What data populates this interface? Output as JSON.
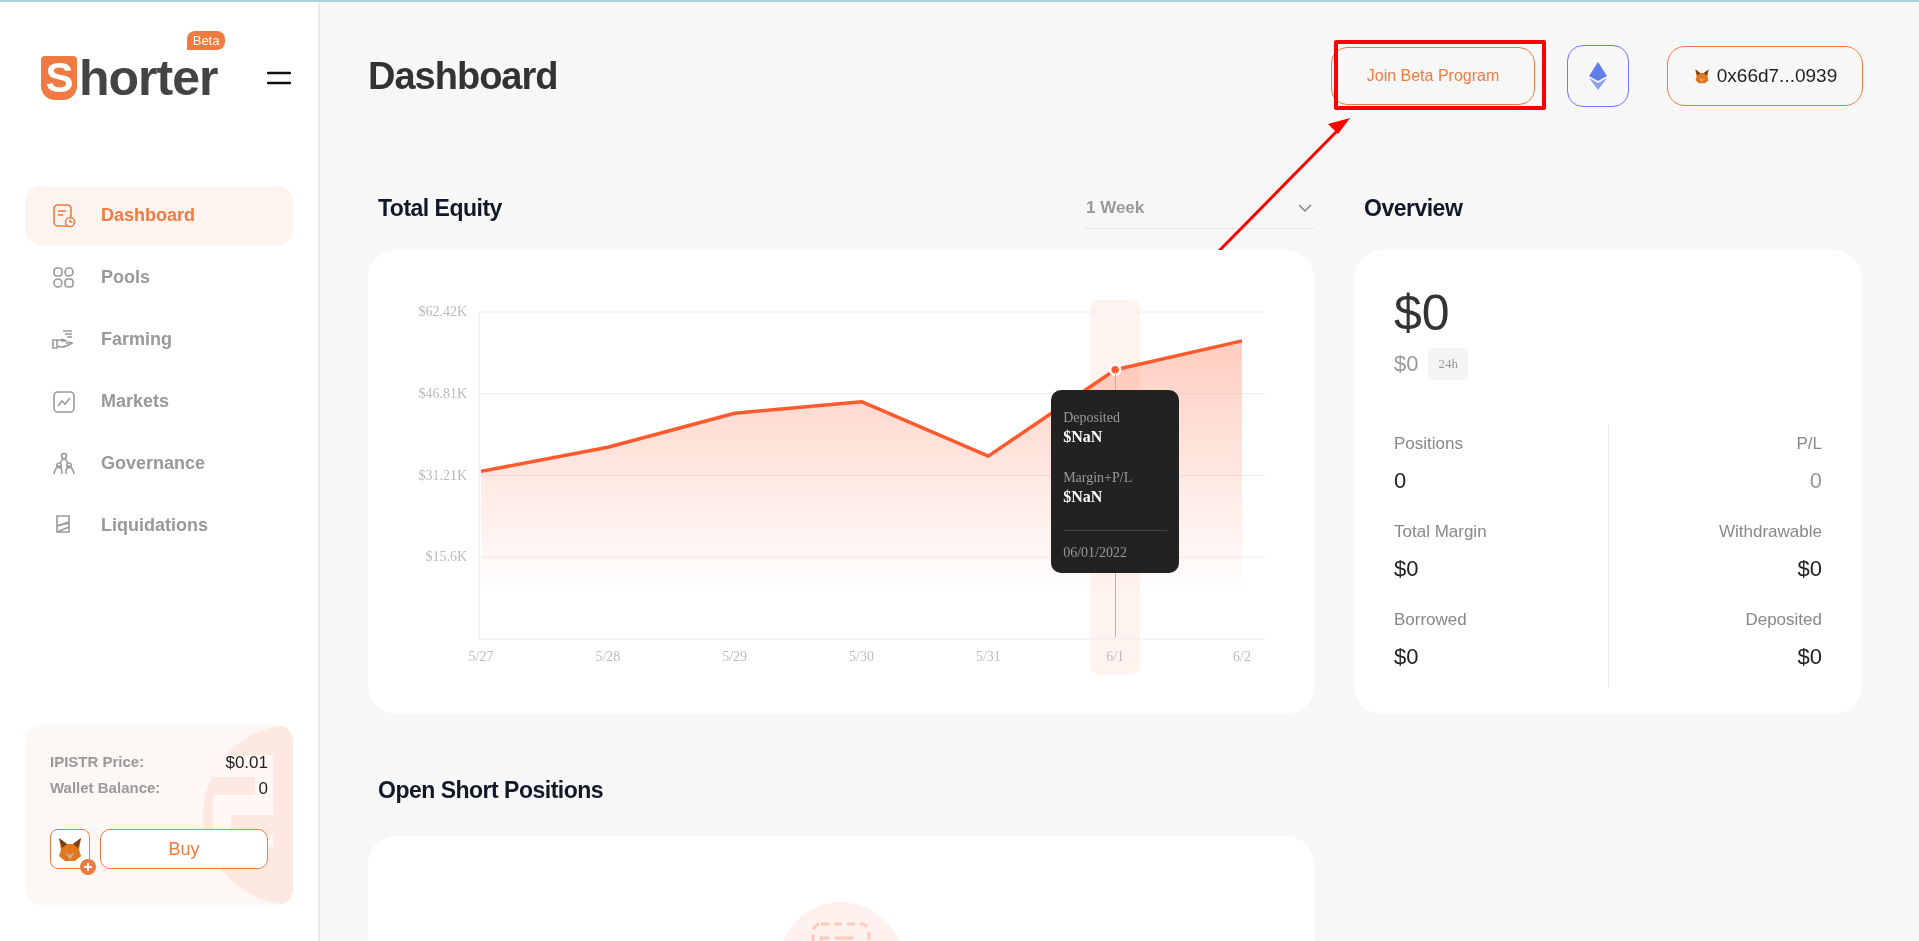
{
  "sidebar": {
    "logo": "Shorter",
    "logo_badge": "Beta",
    "items": [
      {
        "label": "Dashboard",
        "selected": true
      },
      {
        "label": "Pools",
        "selected": false
      },
      {
        "label": "Farming",
        "selected": false
      },
      {
        "label": "Markets",
        "selected": false
      },
      {
        "label": "Governance",
        "selected": false
      },
      {
        "label": "Liquidations",
        "selected": false
      }
    ],
    "token_card": {
      "rows": [
        {
          "label": "IPISTR Price:",
          "value": "$0.01"
        },
        {
          "label": "Wallet Balance:",
          "value": "0"
        }
      ],
      "buy_button": "Buy"
    }
  },
  "header": {
    "title": "Dashboard",
    "join_button": "Join Beta Program",
    "wallet_button": "0x66d7...0939"
  },
  "total_equity": {
    "title": "Total Equity",
    "period": "1 Week",
    "chart_data": {
      "type": "area",
      "categories": [
        "5/27",
        "5/28",
        "5/29",
        "5/30",
        "5/31",
        "6/1",
        "6/2"
      ],
      "grid": true,
      "series": [
        {
          "color": "#ff5a2e",
          "values": [
            32000,
            36600,
            43100,
            45300,
            34900,
            51400,
            56900
          ]
        }
      ],
      "ylim": [
        0,
        62420
      ],
      "yticks": [
        {
          "value": 15600,
          "label": "$15.6K"
        },
        {
          "value": 31210,
          "label": "$31.21K"
        },
        {
          "value": 46810,
          "label": "$46.81K"
        },
        {
          "value": 62420,
          "label": "$62.42K"
        }
      ]
    },
    "tooltip": {
      "hovered": [
        false,
        false,
        false,
        false,
        false,
        true,
        false
      ],
      "rows": [
        {
          "label": "Deposited",
          "value": "$NaN"
        },
        {
          "label": "Margin+P/L",
          "value": "$NaN"
        }
      ],
      "date": "06/01/2022"
    }
  },
  "overview": {
    "title": "Overview",
    "total": "$0",
    "change": "$0",
    "change_period": "24h",
    "stats": [
      {
        "label": "Positions",
        "value": "0",
        "muted": false
      },
      {
        "label": "P/L",
        "value": "0",
        "muted": true
      },
      {
        "label": "Total Margin",
        "value": "$0",
        "muted": false
      },
      {
        "label": "Withdrawable",
        "value": "$0",
        "muted": false
      },
      {
        "label": "Borrowed",
        "value": "$0",
        "muted": false
      },
      {
        "label": "Deposited",
        "value": "$0",
        "muted": false
      }
    ]
  },
  "open_short_positions": {
    "title": "Open Short Positions"
  }
}
